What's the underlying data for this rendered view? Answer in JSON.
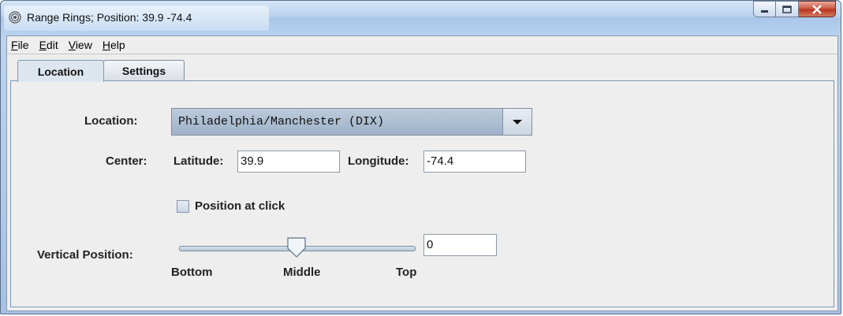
{
  "window": {
    "title": "Range Rings; Position: 39.9 -74.4",
    "icon": "range-rings-icon"
  },
  "menu": [
    {
      "mnemonic": "F",
      "rest": "ile"
    },
    {
      "mnemonic": "E",
      "rest": "dit"
    },
    {
      "mnemonic": "V",
      "rest": "iew"
    },
    {
      "mnemonic": "H",
      "rest": "elp"
    }
  ],
  "tabs": {
    "location": "Location",
    "settings": "Settings"
  },
  "form": {
    "location_label": "Location:",
    "location_value": "Philadelphia/Manchester (DIX)",
    "center_label": "Center:",
    "latitude_label": "Latitude:",
    "latitude_value": "39.9",
    "longitude_label": "Longitude:",
    "longitude_value": "-74.4",
    "position_at_click_label": "Position at click",
    "position_at_click_checked": false,
    "vertical_position_label": "Vertical Position:",
    "slider": {
      "bottom": "Bottom",
      "middle": "Middle",
      "top": "Top",
      "level": 0.5
    },
    "vertical_value": "0"
  },
  "colors": {
    "close_button": "#c9533c",
    "combo_bg": "#b0c1d4",
    "panel_border": "#7a98b6"
  }
}
